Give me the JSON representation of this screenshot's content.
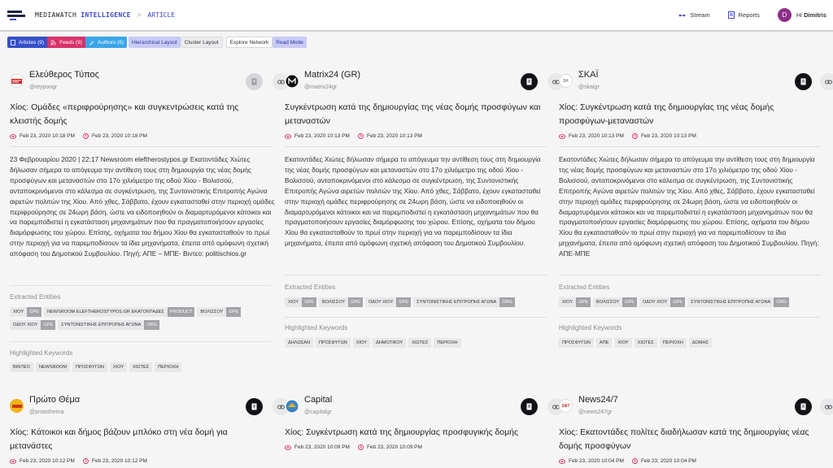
{
  "header": {
    "brand_a": "MEDIAWATCH",
    "brand_b": "INTELLIGENCE",
    "crumb_sep": ">",
    "crumb": "ARTICLE",
    "stream": "Stream",
    "reports": "Reports",
    "avatar_letter": "D",
    "hi": "Hi",
    "user": "Dimitris"
  },
  "filters": {
    "articles": "Articles (9)",
    "feeds": "Feeds (9)",
    "authors": "Authors (6)",
    "hierarchical": "Hierarchical Layout",
    "cluster": "Cluster Layout",
    "explore": "Explore Network",
    "read": "Read Mode"
  },
  "labels": {
    "entities": "Extracted Entities",
    "keywords": "Highlighted Keywords"
  },
  "colors": {
    "accent": "#3b46c8",
    "articles": "#3650c8",
    "feeds": "#d8336a",
    "authors": "#3aa6e8",
    "date_icon": "#e0305a"
  },
  "cards": [
    {
      "name": "Ελεύθερος Τύπος",
      "handle": "@etypoogr",
      "logo_text": "ΕΛ.ΤΥΠΟΣ",
      "title": "Χίος: Ομάδες «περιφρούρησης» και συγκεντρώσεις κατά της κλειστής δομής",
      "date_published": "Feb 23, 2020 10:18 PM",
      "date_crawled": "Feb 23, 2020 10:18 PM",
      "body": "23 Φεβρουαρίου 2020 | 22:17 Newsroom eleftherostypos.gr Εκατοντάδες Χιώτες δήλωσαν σήμερα το απόγευμα την αντίθεση τους στη δημιουργία της νέας δομής προσφύγων και μεταναστών στο 17ο χιλιόμετρο της οδού Χίου - Βολισσού, ανταποκρινόμενοι στο κάλεσμα σε συγκέντρωση, της Συντονιστικής Επιτροπής Αγώνα αιρετών πολιτών της Χίου. Από χθες, Σάββατο, έχουν εγκατασταθεί στην περιοχή ομάδες περιφρούρησης σε 24ωρη βάση, ώστε να ειδοποιηθούν οι διαμαρτυρόμενοι κάτοικοι και να παρεμποδιστεί η εγκατάσταση μηχανημάτων που θα πραγματοποιήσουν εργασίες διαμόρφωσης του χώρου. Επίσης, οχήματα του δήμου Χίου θα εγκατασταθούν το πρωί στην περιοχή για να παρεμποδίσουν τα ίδια μηχανήματα, έπειτα από ομόφωνη σχετική απόφαση του Δημοτικού Συμβουλίου. Πηγή: ΑΠΕ – ΜΠΕ- Βιντεο: politischios.gr",
      "entities": [
        {
          "text": "ΧΙΟΥ",
          "type": "GPE"
        },
        {
          "text": "NEWSROOM ELEFTHEROSTYPOS.GR ΕΚΑΤΟΝΤΑΔΕΣ",
          "type": "PRODUCT"
        },
        {
          "text": "ΒΟΛΙΣΣΟΥ",
          "type": "GPE"
        },
        {
          "text": "ΟΔΟΥ ΧΙΟΥ",
          "type": "GPE"
        },
        {
          "text": "ΣΥΝΤΟΝΙΣΤΙΚΗΣ ΕΠΙΤΡΟΠΗΣ ΑΓΩΝΑ",
          "type": "ORG"
        }
      ],
      "keywords": [
        "ΒΙΝΤΕΟ",
        "NEWSROOM",
        "ΠΡΟΣΦΥΓΩΝ",
        "ΧΙΟΥ",
        "ΧΙΩΤΕΣ",
        "ΠΕΡΙΟΧΗ"
      ]
    },
    {
      "name": "Matrix24 (GR)",
      "handle": "@matrix24gr",
      "logo_text": "M",
      "title": "Συγκέντρωση κατά της δημιουργίας της νέας δομής προσφύγων και μεταναστών",
      "date_published": "Feb 23, 2020 10:13 PM",
      "date_crawled": "Feb 23, 2020 10:13 PM",
      "body": "Εκατοντάδες Χιώτες δήλωσαν σήμερα το απόγευμα την αντίθεση τους στη δημιουργία της νέας δομής προσφύγων και μεταναστών στο 17ο χιλιόμετρο της οδού Χίου - Βολισσού, ανταποκρινόμενοι στο κάλεσμα σε συγκέντρωση, της Συντονιστικής Επιτροπής Αγώνα αιρετών πολιτών της Χίου. Από χθες, Σάββατο, έχουν εγκατασταθεί στην περιοχή ομάδες περιφρούρησης σε 24ωρη βάση, ώστε να ειδοποιηθούν οι διαμαρτυρόμενοι κάτοικοι και να παρεμποδιστεί η εγκατάσταση μηχανημάτων που θα πραγματοποιήσουν εργασίες διαμόρφωσης του χώρου. Επίσης, οχήματα του δήμου Χίου θα εγκατασταθούν το πρωί στην περιοχή για να παρεμποδίσουν τα ίδια μηχανήματα, έπειτα από ομόφωνη σχετική απόφαση του Δημοτικού Συμβουλίου.",
      "entities": [
        {
          "text": "ΧΙΟΥ",
          "type": "GPE"
        },
        {
          "text": "ΒΟΛΙΣΣΟΥ",
          "type": "GPE"
        },
        {
          "text": "ΟΔΟΥ ΧΙΟΥ",
          "type": "GPE"
        },
        {
          "text": "ΣΥΝΤΟΝΙΣΤΙΚΗΣ ΕΠΙΤΡΟΠΗΣ ΑΓΩΝΑ",
          "type": "ORG"
        }
      ],
      "keywords": [
        "ΔΗΛΩΣΑΝ",
        "ΠΡΟΣΦΥΓΩΝ",
        "ΧΙΟΥ",
        "ΔΗΜΟΤΙΚΟΥ",
        "ΧΙΩΤΕΣ",
        "ΠΕΡΙΟΧΗ"
      ]
    },
    {
      "name": "ΣΚΑΪ",
      "handle": "@skaigr",
      "logo_text": "SK",
      "title": "Χίος: Συγκέντρωση κατά της δημιουργίας της νέας δομής προσφύγων-μεταναστών",
      "date_published": "Feb 23, 2020 10:13 PM",
      "date_crawled": "Feb 23, 2020 10:13 PM",
      "body": "Εκατοντάδες Χιώτες δήλωσαν σήμερα το απόγευμα την αντίθεση τους στη δημιουργία της νέας δομής προσφύγων και μεταναστών στο 17ο χιλιόμετρο της οδού Χίου - Βολισσού, ανταποκρινόμενοι στο κάλεσμα σε συγκέντρωση, της Συντονιστικής Επιτροπής Αγώνα αιρετών πολιτών της Χίου. Από χθες, Σάββατο, έχουν εγκατασταθεί στην περιοχή ομάδες περιφρούρησης σε 24ωρη βάση, ώστε να ειδοποιηθούν οι διαμαρτυρόμενοι κάτοικοι και να παρεμποδιστεί η εγκατάσταση μηχανημάτων που θα πραγματοποιήσουν εργασίες διαμόρφωσης του χώρου. Επίσης, οχήματα του δήμου Χίου θα εγκατασταθούν το πρωί στην περιοχή για να παρεμποδίσουν τα ίδια μηχανήματα, έπειτα από ομόφωνη σχετική απόφαση του Δημοτικού Συμβουλίου. Πηγή: ΑΠΕ-ΜΠΕ",
      "entities": [
        {
          "text": "ΧΙΟΥ",
          "type": "GPE"
        },
        {
          "text": "ΒΟΛΙΣΣΟΥ",
          "type": "GPE"
        },
        {
          "text": "ΟΔΟΥ ΧΙΟΥ",
          "type": "GPE"
        },
        {
          "text": "ΣΥΝΤΟΝΙΣΤΙΚΗΣ ΕΠΙΤΡΟΠΗΣ ΑΓΩΝΑ",
          "type": "ORG"
        }
      ],
      "keywords": [
        "ΠΡΟΣΦΥΓΩΝ",
        "ΑΠΕ",
        "ΧΙΟΥ",
        "ΧΙΩΤΕΣ",
        "ΠΕΡΙΟΧΗ",
        "ΔΟΜΗΣ"
      ]
    },
    {
      "name": "Πρώτο Θέμα",
      "handle": "@protothema",
      "logo_text": "ΘΕΜΑ",
      "title": "Χίος: Κάτοικοι και δήμος βάζουν μπλόκο στη νέα δομή για μετανάστες",
      "date_published": "Feb 23, 2020 10:12 PM",
      "date_crawled": "Feb 23, 2020 10:12 PM"
    },
    {
      "name": "Capital",
      "handle": "@capitalgr",
      "logo_text": "C",
      "title": "Χίος: Συγκέντρωση κατά της δημιουργίας προσφυγικής δομής",
      "date_published": "Feb 23, 2020 10:09 PM",
      "date_crawled": "Feb 23, 2020 10:09 PM"
    },
    {
      "name": "News24/7",
      "handle": "@news247gr",
      "logo_text": "24/7",
      "title": "Χίος: Εκατοντάδες πολίτες διαδήλωσαν κατά της δημιουργίας νέας δομής προσφύγων",
      "date_published": "Feb 23, 2020 10:04 PM",
      "date_crawled": "Feb 23, 2020 10:04 PM"
    }
  ]
}
